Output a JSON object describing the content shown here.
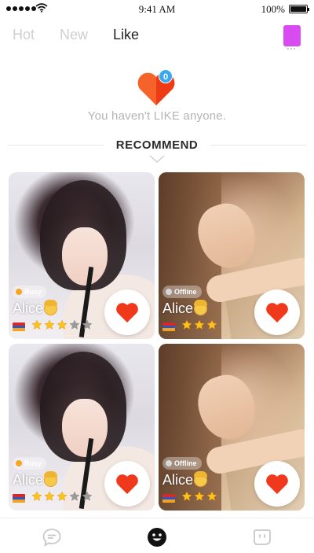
{
  "status_bar": {
    "time": "9:41 AM",
    "battery": "100%",
    "battery_level": 1.0
  },
  "tabs": [
    {
      "label": "Hot",
      "active": false
    },
    {
      "label": "New",
      "active": false
    },
    {
      "label": "Like",
      "active": true
    }
  ],
  "like_badge": "0",
  "empty_message": "You haven't LIKE anyone.",
  "recommend_title": "RECOMMEND",
  "cards": [
    {
      "status": "Busy",
      "status_color": "#f5a623",
      "name": "Alice",
      "rating": 3,
      "max_rating": 5,
      "photo": "a"
    },
    {
      "status": "Offline",
      "status_color": "#d8d8d8",
      "name": "Alice",
      "rating": 3,
      "max_rating": 3,
      "photo": "b"
    },
    {
      "status": "Busy",
      "status_color": "#f5a623",
      "name": "Alice",
      "rating": 3,
      "max_rating": 5,
      "photo": "a"
    },
    {
      "status": "Offline",
      "status_color": "#d8d8d8",
      "name": "Alice",
      "rating": 3,
      "max_rating": 3,
      "photo": "b"
    }
  ],
  "icons": {
    "chat_tab": "chat-bubble-icon",
    "match_tab": "smiley-icon",
    "messages_tab": "message-square-icon"
  },
  "colors": {
    "accent_heart": "#f0381c",
    "profile_button": "#d84bf0",
    "badge": "#3aa8f0"
  }
}
